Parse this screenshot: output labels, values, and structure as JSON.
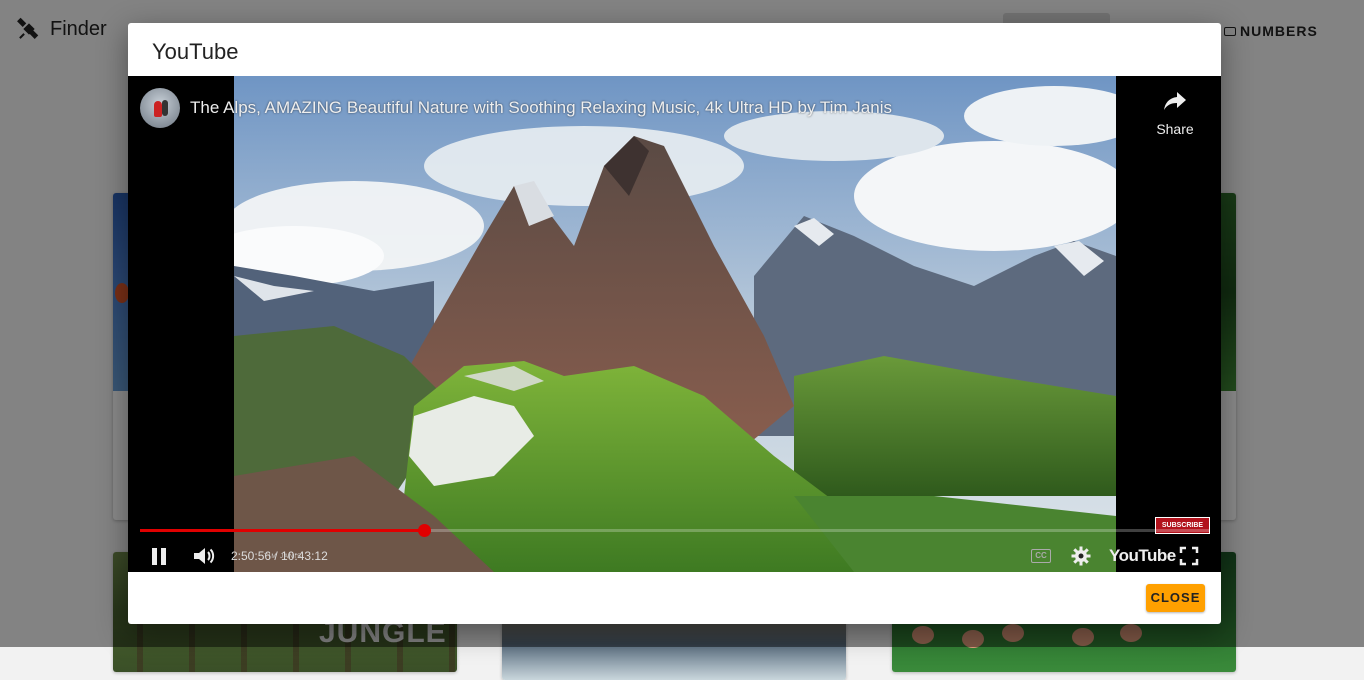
{
  "app": {
    "name": "Finder",
    "nav_numbers": "NUMBERS"
  },
  "background": {
    "card_jungle_title": "JUNGLE"
  },
  "dialog": {
    "title": "YouTube",
    "close_label": "CLOSE"
  },
  "video": {
    "title": "The Alps, AMAZING Beautiful Nature with Soothing Relaxing Music, 4k Ultra HD by Tim Janis",
    "share_label": "Share",
    "subscribe_label": "SUBSCRIBE",
    "time_display": "2:50:56 / 10:43:12",
    "watermark": "TIM JANIS",
    "youtube_logo_text": "YouTube",
    "progress_fraction": 0.266,
    "progress_color": "#e00000",
    "state": "playing"
  },
  "colors": {
    "close_button": "#ffa000",
    "subscribe_badge": "#b2121c"
  }
}
